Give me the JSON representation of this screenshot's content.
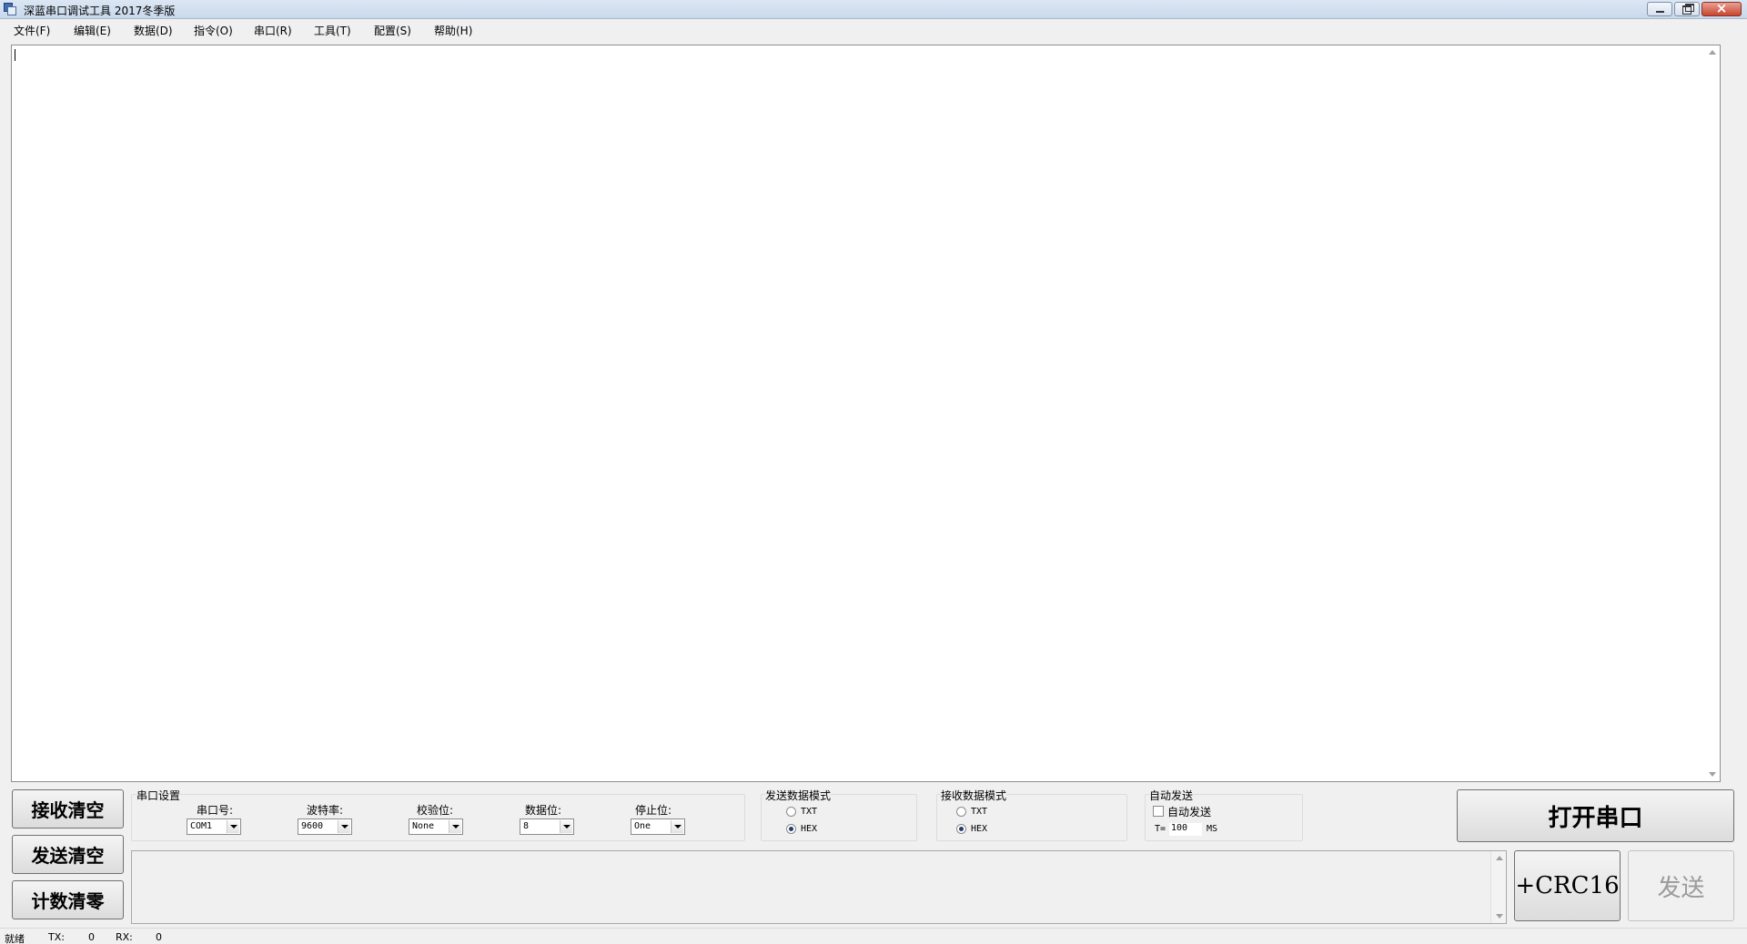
{
  "window": {
    "title": "深蓝串口调试工具 2017冬季版",
    "buttons": [
      "minimize",
      "maximize",
      "close"
    ]
  },
  "menu": [
    "文件(F)",
    "编辑(E)",
    "数据(D)",
    "指令(O)",
    "串口(R)",
    "工具(T)",
    "配置(S)",
    "帮助(H)"
  ],
  "left_buttons": {
    "clear_receive": "接收清空",
    "clear_send": "发送清空",
    "reset_count": "计数清零"
  },
  "serial_settings": {
    "group_label": "串口设置",
    "port_label": "串口号:",
    "port_value": "COM1",
    "baud_label": "波特率:",
    "baud_value": "9600",
    "parity_label": "校验位:",
    "parity_value": "None",
    "databits_label": "数据位:",
    "databits_value": "8",
    "stopbits_label": "停止位:",
    "stopbits_value": "One"
  },
  "send_mode": {
    "group_label": "发送数据模式",
    "option_txt": "TXT",
    "option_hex": "HEX",
    "selected": "HEX"
  },
  "recv_mode": {
    "group_label": "接收数据模式",
    "option_txt": "TXT",
    "option_hex": "HEX",
    "selected": "HEX"
  },
  "auto_send": {
    "group_label": "自动发送",
    "checkbox_label": "自动发送",
    "checked": false,
    "interval_prefix": "T=",
    "interval_value": "100",
    "interval_unit": "MS"
  },
  "right_buttons": {
    "open_port": "打开串口",
    "crc16": "+CRC16",
    "send": "发送"
  },
  "status": {
    "state": "就绪",
    "tx_label": "TX:",
    "tx_value": "0",
    "rx_label": "RX:",
    "rx_value": "0"
  }
}
